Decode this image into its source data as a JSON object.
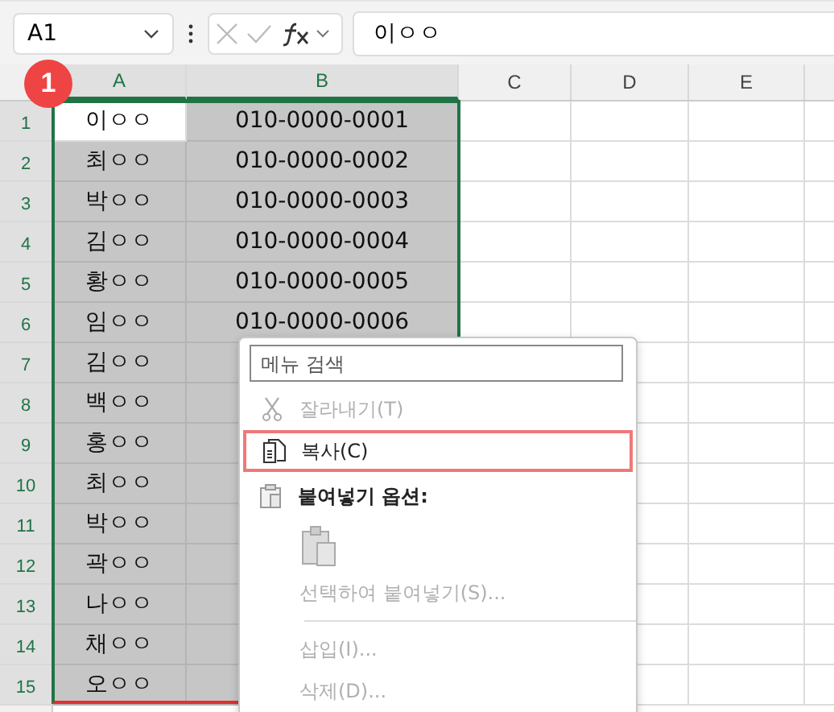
{
  "name_box": "A1",
  "formula": "이ㅇㅇ",
  "columns": [
    {
      "label": "A",
      "selected": true
    },
    {
      "label": "B",
      "selected": true
    },
    {
      "label": "C",
      "selected": false
    },
    {
      "label": "D",
      "selected": false
    },
    {
      "label": "E",
      "selected": false
    }
  ],
  "rows": [
    {
      "n": "1",
      "a": "이ㅇㅇ",
      "b": "010-0000-0001",
      "selected": true,
      "active": true
    },
    {
      "n": "2",
      "a": "최ㅇㅇ",
      "b": "010-0000-0002",
      "selected": true,
      "active": false
    },
    {
      "n": "3",
      "a": "박ㅇㅇ",
      "b": "010-0000-0003",
      "selected": true,
      "active": false
    },
    {
      "n": "4",
      "a": "김ㅇㅇ",
      "b": "010-0000-0004",
      "selected": true,
      "active": false
    },
    {
      "n": "5",
      "a": "황ㅇㅇ",
      "b": "010-0000-0005",
      "selected": true,
      "active": false
    },
    {
      "n": "6",
      "a": "임ㅇㅇ",
      "b": "010-0000-0006",
      "selected": true,
      "active": false
    },
    {
      "n": "7",
      "a": "김ㅇㅇ",
      "selected": true,
      "active": false
    },
    {
      "n": "8",
      "a": "백ㅇㅇ",
      "selected": true,
      "active": false
    },
    {
      "n": "9",
      "a": "홍ㅇㅇ",
      "selected": true,
      "active": false
    },
    {
      "n": "10",
      "a": "최ㅇㅇ",
      "selected": true,
      "active": false
    },
    {
      "n": "11",
      "a": "박ㅇㅇ",
      "selected": true,
      "active": false
    },
    {
      "n": "12",
      "a": "곽ㅇㅇ",
      "selected": true,
      "active": false
    },
    {
      "n": "13",
      "a": "나ㅇㅇ",
      "selected": true,
      "active": false
    },
    {
      "n": "14",
      "a": "채ㅇㅇ",
      "selected": true,
      "active": false
    },
    {
      "n": "15",
      "a": "오ㅇㅇ",
      "selected": true,
      "active": false
    }
  ],
  "step_badge": "1",
  "context_menu": {
    "search": {
      "placeholder": "메뉴 검색"
    },
    "items": [
      {
        "kind": "cut",
        "label": "잘라내기(T)",
        "disabled": true,
        "selected": false
      },
      {
        "kind": "copy",
        "label": "복사(C)",
        "disabled": false,
        "selected": true
      },
      {
        "kind": "heading",
        "label": "붙여넣기 옵션:"
      },
      {
        "kind": "paste-options"
      },
      {
        "kind": "item",
        "label": "선택하여 붙여넣기(S)...",
        "disabled": true,
        "selected": false
      },
      {
        "kind": "divider"
      },
      {
        "kind": "item",
        "label": "삽입(I)...",
        "disabled": true,
        "selected": false
      },
      {
        "kind": "item",
        "label": "삭제(D)...",
        "disabled": true,
        "selected": false
      }
    ]
  }
}
